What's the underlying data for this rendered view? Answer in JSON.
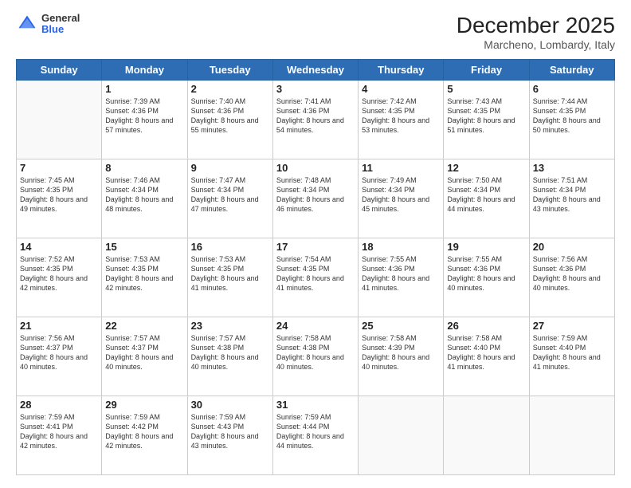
{
  "logo": {
    "general": "General",
    "blue": "Blue"
  },
  "title": "December 2025",
  "location": "Marcheno, Lombardy, Italy",
  "days_header": [
    "Sunday",
    "Monday",
    "Tuesday",
    "Wednesday",
    "Thursday",
    "Friday",
    "Saturday"
  ],
  "weeks": [
    [
      {
        "day": "",
        "sunrise": "",
        "sunset": "",
        "daylight": ""
      },
      {
        "day": "1",
        "sunrise": "7:39 AM",
        "sunset": "4:36 PM",
        "daylight": "8 hours and 57 minutes."
      },
      {
        "day": "2",
        "sunrise": "7:40 AM",
        "sunset": "4:36 PM",
        "daylight": "8 hours and 55 minutes."
      },
      {
        "day": "3",
        "sunrise": "7:41 AM",
        "sunset": "4:36 PM",
        "daylight": "8 hours and 54 minutes."
      },
      {
        "day": "4",
        "sunrise": "7:42 AM",
        "sunset": "4:35 PM",
        "daylight": "8 hours and 53 minutes."
      },
      {
        "day": "5",
        "sunrise": "7:43 AM",
        "sunset": "4:35 PM",
        "daylight": "8 hours and 51 minutes."
      },
      {
        "day": "6",
        "sunrise": "7:44 AM",
        "sunset": "4:35 PM",
        "daylight": "8 hours and 50 minutes."
      }
    ],
    [
      {
        "day": "7",
        "sunrise": "7:45 AM",
        "sunset": "4:35 PM",
        "daylight": "8 hours and 49 minutes."
      },
      {
        "day": "8",
        "sunrise": "7:46 AM",
        "sunset": "4:34 PM",
        "daylight": "8 hours and 48 minutes."
      },
      {
        "day": "9",
        "sunrise": "7:47 AM",
        "sunset": "4:34 PM",
        "daylight": "8 hours and 47 minutes."
      },
      {
        "day": "10",
        "sunrise": "7:48 AM",
        "sunset": "4:34 PM",
        "daylight": "8 hours and 46 minutes."
      },
      {
        "day": "11",
        "sunrise": "7:49 AM",
        "sunset": "4:34 PM",
        "daylight": "8 hours and 45 minutes."
      },
      {
        "day": "12",
        "sunrise": "7:50 AM",
        "sunset": "4:34 PM",
        "daylight": "8 hours and 44 minutes."
      },
      {
        "day": "13",
        "sunrise": "7:51 AM",
        "sunset": "4:34 PM",
        "daylight": "8 hours and 43 minutes."
      }
    ],
    [
      {
        "day": "14",
        "sunrise": "7:52 AM",
        "sunset": "4:35 PM",
        "daylight": "8 hours and 42 minutes."
      },
      {
        "day": "15",
        "sunrise": "7:53 AM",
        "sunset": "4:35 PM",
        "daylight": "8 hours and 42 minutes."
      },
      {
        "day": "16",
        "sunrise": "7:53 AM",
        "sunset": "4:35 PM",
        "daylight": "8 hours and 41 minutes."
      },
      {
        "day": "17",
        "sunrise": "7:54 AM",
        "sunset": "4:35 PM",
        "daylight": "8 hours and 41 minutes."
      },
      {
        "day": "18",
        "sunrise": "7:55 AM",
        "sunset": "4:36 PM",
        "daylight": "8 hours and 41 minutes."
      },
      {
        "day": "19",
        "sunrise": "7:55 AM",
        "sunset": "4:36 PM",
        "daylight": "8 hours and 40 minutes."
      },
      {
        "day": "20",
        "sunrise": "7:56 AM",
        "sunset": "4:36 PM",
        "daylight": "8 hours and 40 minutes."
      }
    ],
    [
      {
        "day": "21",
        "sunrise": "7:56 AM",
        "sunset": "4:37 PM",
        "daylight": "8 hours and 40 minutes."
      },
      {
        "day": "22",
        "sunrise": "7:57 AM",
        "sunset": "4:37 PM",
        "daylight": "8 hours and 40 minutes."
      },
      {
        "day": "23",
        "sunrise": "7:57 AM",
        "sunset": "4:38 PM",
        "daylight": "8 hours and 40 minutes."
      },
      {
        "day": "24",
        "sunrise": "7:58 AM",
        "sunset": "4:38 PM",
        "daylight": "8 hours and 40 minutes."
      },
      {
        "day": "25",
        "sunrise": "7:58 AM",
        "sunset": "4:39 PM",
        "daylight": "8 hours and 40 minutes."
      },
      {
        "day": "26",
        "sunrise": "7:58 AM",
        "sunset": "4:40 PM",
        "daylight": "8 hours and 41 minutes."
      },
      {
        "day": "27",
        "sunrise": "7:59 AM",
        "sunset": "4:40 PM",
        "daylight": "8 hours and 41 minutes."
      }
    ],
    [
      {
        "day": "28",
        "sunrise": "7:59 AM",
        "sunset": "4:41 PM",
        "daylight": "8 hours and 42 minutes."
      },
      {
        "day": "29",
        "sunrise": "7:59 AM",
        "sunset": "4:42 PM",
        "daylight": "8 hours and 42 minutes."
      },
      {
        "day": "30",
        "sunrise": "7:59 AM",
        "sunset": "4:43 PM",
        "daylight": "8 hours and 43 minutes."
      },
      {
        "day": "31",
        "sunrise": "7:59 AM",
        "sunset": "4:44 PM",
        "daylight": "8 hours and 44 minutes."
      },
      {
        "day": "",
        "sunrise": "",
        "sunset": "",
        "daylight": ""
      },
      {
        "day": "",
        "sunrise": "",
        "sunset": "",
        "daylight": ""
      },
      {
        "day": "",
        "sunrise": "",
        "sunset": "",
        "daylight": ""
      }
    ]
  ]
}
